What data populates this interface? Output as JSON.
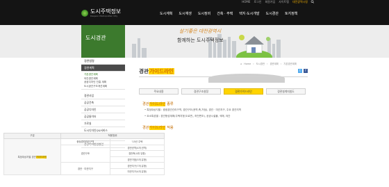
{
  "header": {
    "util": [
      "HOME",
      "로그인",
      "회원가입",
      "사이트맵",
      "대전광역시청"
    ],
    "logo_kr": "도시주택정보",
    "logo_en": "Daejeon Metropolitan City",
    "nav": [
      "도시계획",
      "도시재생",
      "도시정비",
      "건축 · 주택",
      "택지·도시개발",
      "도시경관",
      "토지정책"
    ]
  },
  "banner": {
    "section_title": "도시경관",
    "slogan_script": "살기좋은 대전광역시",
    "slogan_main": "함께하는 도시주택정보"
  },
  "sidebar": {
    "heading1": "경관법령",
    "heading2": "경관계획",
    "subs": [
      "기본경관계획",
      "야간경관계획",
      "공공디자인 진흥 계획",
      "도시공간구조개선계획"
    ],
    "items": [
      "경관사업",
      "공공건축",
      "공공디자인",
      "공공들이터",
      "가로실",
      "도시디자인Q&서비스",
      "도시경관자료아카이브",
      "공공디자인인실입"
    ]
  },
  "breadcrumb": [
    "Home",
    "도시경관",
    "경관계획",
    "기본경관계획"
  ],
  "page": {
    "title_plain": "경관",
    "title_mark": "가이드라인",
    "tabs": [
      "주요내용",
      "경관구조설정",
      "경관가이드라인",
      "경관설계지침도"
    ],
    "sec1_a": "경관",
    "sec1_b": "가이드라인",
    "sec1_c": " 종류",
    "bullet1": "특정대상지별 : 중점경관관리구역, 경관구조(권역,축,거점), 경관 · 미관지구, 주요 경관지역",
    "bullet2": "요소특성별 : 경관형성계획(주택지형,도로변,, 하천변조), 공공시설물, 색채, 야간",
    "sec2_a": "경관",
    "sec2_b": "가이드라인",
    "sec2_c": " 적용",
    "table": {
      "headers": [
        "구분",
        "적용범위"
      ],
      "left_label_plain": "특정대상지별 경관",
      "left_label_mark": "가이드라인",
      "rows": [
        [
          "",
          "중점경관관리구역",
          "'15년 주택"
        ],
        [
          "",
          "",
          "경관권역(4개 권역)"
        ],
        [
          "",
          "경관구조",
          "경관축(4개 유형)"
        ],
        [
          "",
          "",
          "경관거점(5개 유형)"
        ],
        [
          "",
          "경관 · 미관지구",
          "경관지구(7개 유형)"
        ],
        [
          "",
          "",
          "미관지구(4개 유형)"
        ]
      ]
    }
  },
  "colors": {
    "accent": "#ffd400",
    "green": "#3c7a2d",
    "orange": "#c46c00"
  }
}
